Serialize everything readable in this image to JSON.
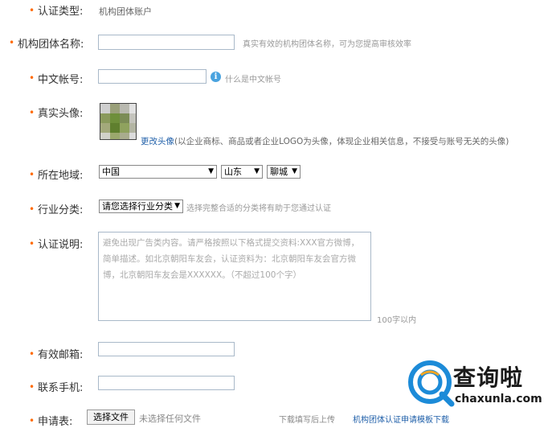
{
  "form": {
    "auth_type": {
      "label": "认证类型:",
      "value": "机构团体账户"
    },
    "org_name": {
      "label": "机构团体名称:",
      "hint": "真实有效的机构团体名称，可为您提高审核效率"
    },
    "cn_account": {
      "label": "中文帐号:",
      "hint": "什么是中文帐号"
    },
    "avatar": {
      "label": "真实头像:",
      "change_link": "更改头像",
      "hint": "(以企业商标、商品或者企业LOGO为头像，体现企业相关信息，不接受与账号无关的头像)"
    },
    "location": {
      "label": "所在地域:",
      "country": "中国",
      "province": "山东",
      "city": "聊城"
    },
    "industry": {
      "label": "行业分类:",
      "select": "请您选择行业分类",
      "hint": "选择完整合适的分类将有助于您通过认证"
    },
    "description": {
      "label": "认证说明:",
      "placeholder": "避免出现广告类内容。请严格按照以下格式提交资料:XXX官方微博，简单描述。如北京朝阳车友会，认证资料为：北京朝阳车友会官方微博，北京朝阳车友会是XXXXXX。（不超过100个字）",
      "limit": "100字以内"
    },
    "email": {
      "label": "有效邮箱:"
    },
    "phone": {
      "label": "联系手机:"
    },
    "application": {
      "label": "申请表:",
      "button": "选择文件",
      "no_file": "未选择任何文件",
      "hint": "下载填写后上传",
      "template_link": "机构团体认证申请模板下载"
    }
  },
  "watermark": {
    "brand": "查询啦",
    "domain": "chaxunla.com"
  },
  "colors": {
    "required_dot": "#ff6a00",
    "link": "#1f5fa9",
    "input_border": "#a9b9c9",
    "info_icon": "#4aa3df",
    "watermark_blue": "#1c8bd8"
  }
}
